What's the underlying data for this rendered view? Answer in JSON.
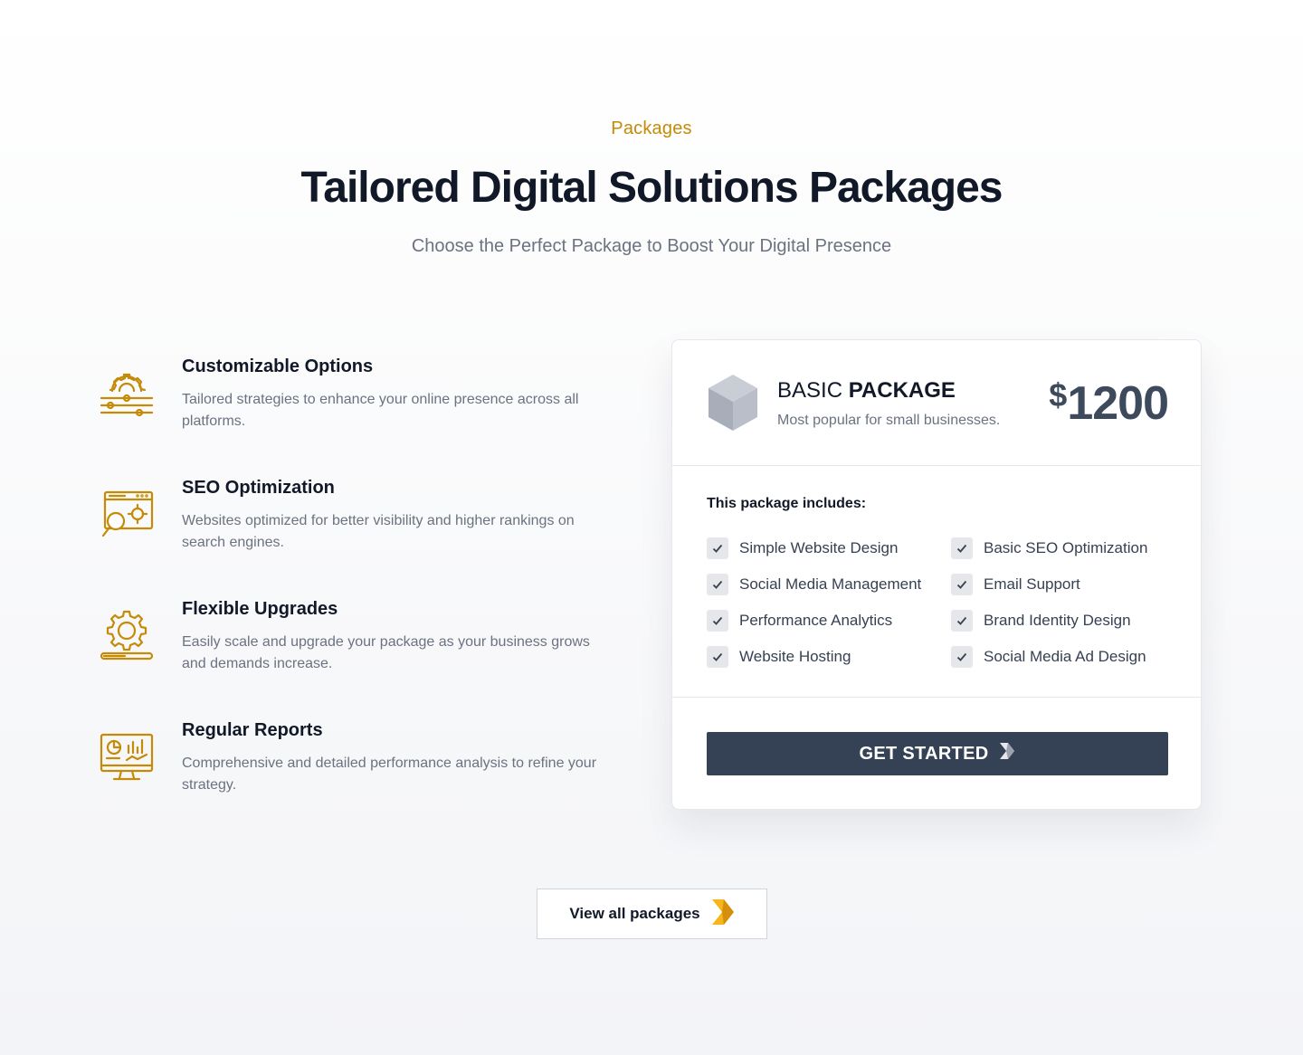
{
  "header": {
    "eyebrow": "Packages",
    "title": "Tailored Digital Solutions Packages",
    "subtitle": "Choose the Perfect Package to Boost Your Digital Presence"
  },
  "features": [
    {
      "icon": "gear-sliders-icon",
      "title": "Customizable Options",
      "text": "Tailored strategies to enhance your online presence across all platforms."
    },
    {
      "icon": "seo-browser-icon",
      "title": "SEO Optimization",
      "text": "Websites optimized for better visibility and higher rankings on search engines."
    },
    {
      "icon": "gear-progress-icon",
      "title": "Flexible Upgrades",
      "text": "Easily scale and upgrade your package as your business grows and demands increase."
    },
    {
      "icon": "monitor-chart-icon",
      "title": "Regular Reports",
      "text": "Comprehensive and detailed performance analysis to refine your strategy."
    }
  ],
  "package": {
    "name_light": "BASIC",
    "name_bold": "PACKAGE",
    "tagline": "Most popular for small businesses.",
    "currency": "$",
    "price": "1200",
    "includes_label": "This package includes:",
    "items": [
      "Simple Website Design",
      "Basic SEO Optimization",
      "Social Media Management",
      "Email Support",
      "Performance Analytics",
      "Brand Identity Design",
      "Website Hosting",
      "Social Media Ad Design"
    ],
    "cta_label": "GET STARTED"
  },
  "view_all_label": "View all packages",
  "colors": {
    "accent": "#c58a06",
    "dark_button": "#354154",
    "price": "#3d4a5c"
  }
}
